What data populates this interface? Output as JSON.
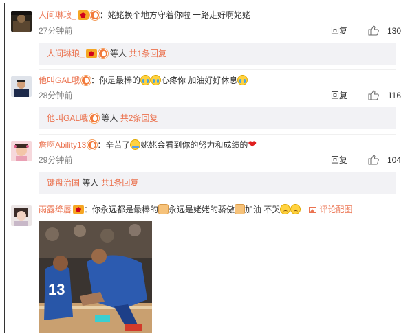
{
  "comments": [
    {
      "username": "人间琳琅_",
      "text": "：姥姥换个地方守着你啦 一路走好啊姥姥",
      "time": "27分钟前",
      "reply_label": "回复",
      "likes": "130",
      "sub": {
        "name": "人间琳琅_",
        "suffix": " 等人 ",
        "more": "共1条回复"
      }
    },
    {
      "username": "他叫GAL哦",
      "text_a": "：你是最棒的",
      "text_b": "心疼你 加油好好休息",
      "time": "28分钟前",
      "reply_label": "回复",
      "likes": "116",
      "sub": {
        "name": "他叫GAL哦",
        "suffix": " 等人 ",
        "more": "共2条回复"
      }
    },
    {
      "username": "詹啊Ability13",
      "text_a": "：辛苦了",
      "text_b": "姥姥会看到你的努力和成绩的",
      "time": "29分钟前",
      "reply_label": "回复",
      "likes": "104",
      "sub": {
        "name": "键盘治国",
        "suffix": " 等人 ",
        "more": "共1条回复"
      }
    },
    {
      "username": "雨露绛唇",
      "text_a": "：你永远都是最棒的",
      "text_b": "永远是姥姥的骄傲",
      "text_c": "加油 不哭",
      "pic_label": "评论配图"
    }
  ],
  "icons": [
    "vip-badge-icon",
    "fire-badge-icon",
    "thumbs-up-icon",
    "picture-icon",
    "crying-emoji-icon",
    "heart-emoji-icon",
    "thumb-emoji-icon",
    "sad-emoji-icon"
  ],
  "colors": {
    "link": "#eb7350",
    "subbox_bg": "#f2f2f5",
    "text": "#333333",
    "meta": "#808080"
  }
}
